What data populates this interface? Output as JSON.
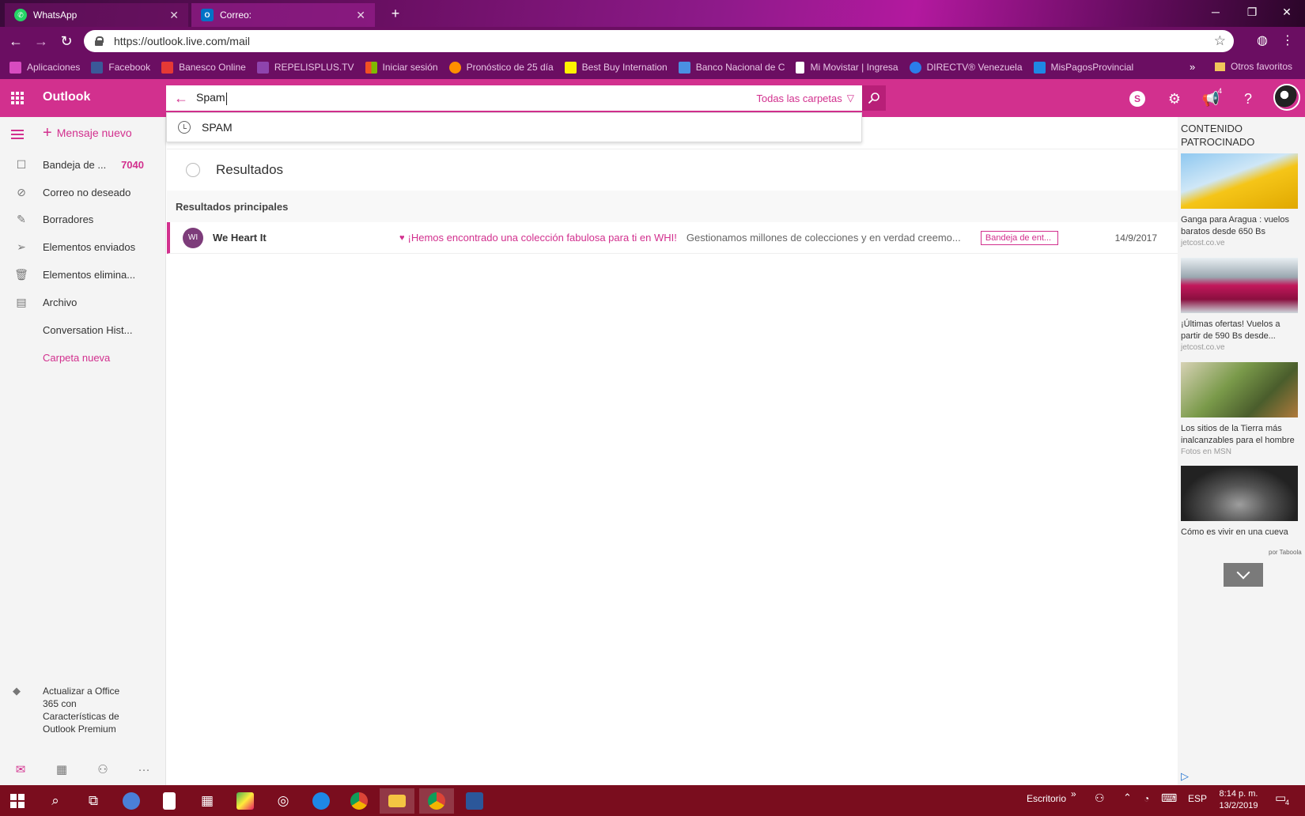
{
  "browser": {
    "tabs": [
      {
        "label": "WhatsApp",
        "icon": "whatsapp-icon",
        "color": "#25d366"
      },
      {
        "label": "Correo:",
        "icon": "outlook-icon",
        "color": "#0072c6"
      }
    ],
    "url": "https://outlook.live.com/mail",
    "bookmarks": [
      {
        "label": "Aplicaciones",
        "color": "#d84bc0"
      },
      {
        "label": "Facebook",
        "color": "#3b5998"
      },
      {
        "label": "Banesco Online",
        "color": "#e53935"
      },
      {
        "label": "REPELISPLUS.TV",
        "color": "#8e44ad"
      },
      {
        "label": "Iniciar sesión",
        "color": "#f25022"
      },
      {
        "label": "Pronóstico de 25 día",
        "color": "#ff8f00"
      },
      {
        "label": "Best Buy Internation",
        "color": "#fff200"
      },
      {
        "label": "Banco Nacional de C",
        "color": "#4a90e2"
      },
      {
        "label": "Mi Movistar | Ingresa",
        "color": "#ffffff"
      },
      {
        "label": "DIRECTV® Venezuela",
        "color": "#2b7de9"
      },
      {
        "label": "MisPagosProvincial",
        "color": "#1e88e5"
      }
    ],
    "other_bookmarks": "Otros favoritos"
  },
  "outlook": {
    "brand": "Outlook",
    "search": {
      "query": "Spam",
      "scope": "Todas las carpetas"
    },
    "suggestion": "SPAM",
    "notification_count": "4"
  },
  "nav": {
    "new_message": "Mensaje nuevo",
    "items": [
      {
        "label": "Bandeja de ...",
        "count": "7040",
        "icon": "inbox-icon",
        "glyph": "☐"
      },
      {
        "label": "Correo no deseado",
        "count": "",
        "icon": "junk-icon",
        "glyph": "⊘"
      },
      {
        "label": "Borradores",
        "count": "",
        "icon": "pencil-icon",
        "glyph": "✎"
      },
      {
        "label": "Elementos enviados",
        "count": "",
        "icon": "send-icon",
        "glyph": "➢"
      },
      {
        "label": "Elementos elimina...",
        "count": "",
        "icon": "trash-icon",
        "glyph": "🗑"
      },
      {
        "label": "Archivo",
        "count": "",
        "icon": "archive-icon",
        "glyph": "▤"
      },
      {
        "label": "Conversation Hist...",
        "count": "",
        "icon": "",
        "glyph": ""
      },
      {
        "label": "Carpeta nueva",
        "count": "",
        "icon": "",
        "glyph": ""
      }
    ],
    "upgrade_text": "Actualizar a Office 365 con Características de Outlook Premium"
  },
  "results": {
    "title": "Resultados",
    "section": "Resultados principales",
    "messages": [
      {
        "initials": "WI",
        "sender": "We Heart It",
        "subject": "¡Hemos encontrado una colección fabulosa para ti en WHI!",
        "preview": "Gestionamos millones de colecciones y en verdad creemo...",
        "folder": "Bandeja de ent...",
        "date": "14/9/2017"
      }
    ]
  },
  "sponsored": {
    "title": "CONTENIDO PATROCINADO",
    "ads": [
      {
        "caption": "Ganga para Aragua : vuelos baratos desde 650 Bs",
        "source": "jetcost.co.ve",
        "tone": "#f5c518"
      },
      {
        "caption": "¡Últimas ofertas! Vuelos a partir de 590 Bs desde...",
        "source": "jetcost.co.ve",
        "tone": "#c2185b"
      },
      {
        "caption": "Los sitios de la Tierra más inalcanzables para el hombre",
        "source": "Fotos en MSN",
        "tone": "#7a9a4a"
      },
      {
        "caption": "Cómo es vivir en una cueva",
        "source": "",
        "tone": "#3a3a3a"
      }
    ],
    "provider": "por Taboola"
  },
  "taskbar": {
    "desktop_label": "Escritorio",
    "language": "ESP",
    "time": "8:14 p. m.",
    "date": "13/2/2019",
    "notifications": "4"
  }
}
